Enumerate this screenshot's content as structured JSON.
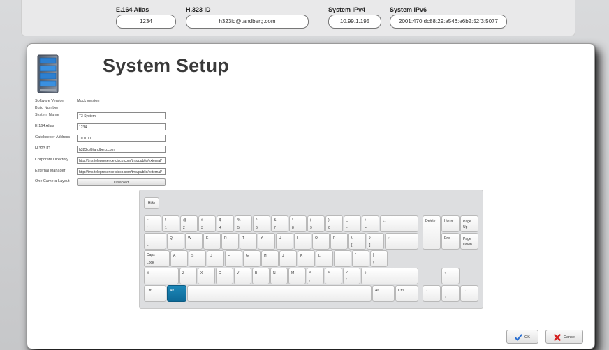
{
  "header": {
    "fields": [
      {
        "label": "E.164 Alias",
        "value": "1234"
      },
      {
        "label": "H.323 ID",
        "value": "h323id@tandberg.com"
      },
      {
        "label": "System IPv4",
        "value": "10.99.1.195"
      },
      {
        "label": "System IPv6",
        "value": "2001:470:dc88:29:a546:e6b2:52f3:5077"
      }
    ]
  },
  "window": {
    "title": "System Setup",
    "icon": "server-icon",
    "form": {
      "software_version_label": "Software Version",
      "software_version_value": "Mock version",
      "build_number_label": "Build Number",
      "rows": [
        {
          "label": "System Name",
          "value": "T3 System"
        },
        {
          "label": "E.164 Alias",
          "value": "1234"
        },
        {
          "label": "Gatekeeper Address",
          "value": "10.0.0.1"
        },
        {
          "label": "H.323 ID",
          "value": "h323id@tandberg.com"
        },
        {
          "label": "Corporate Directory",
          "value": "http://tms.telepresence.cisco.com/tms/public/external/"
        },
        {
          "label": "External Manager",
          "value": "http://tms.telepresence.cisco.com/tms/public/external/"
        }
      ],
      "one_camera_layout_label": "One Camera Layout",
      "one_camera_layout_value": "Disabled"
    },
    "keyboard": {
      "hide_label": "Hide",
      "number_row": [
        {
          "p": "~",
          "s": "`"
        },
        {
          "p": "!",
          "s": "1"
        },
        {
          "p": "@",
          "s": "2"
        },
        {
          "p": "#",
          "s": "3"
        },
        {
          "p": "$",
          "s": "4"
        },
        {
          "p": "%",
          "s": "5"
        },
        {
          "p": "^",
          "s": "6"
        },
        {
          "p": "&",
          "s": "7"
        },
        {
          "p": "*",
          "s": "8"
        },
        {
          "p": "(",
          "s": "9"
        },
        {
          "p": ")",
          "s": "0"
        },
        {
          "p": "_",
          "s": "-"
        },
        {
          "p": "+",
          "s": "="
        }
      ],
      "backspace": "←",
      "tab": {
        "p": "→",
        "s": "←"
      },
      "qwerty_row": [
        "Q",
        "W",
        "E",
        "R",
        "T",
        "Y",
        "U",
        "I",
        "O",
        "P"
      ],
      "bracket_keys": [
        {
          "p": "{",
          "s": "["
        },
        {
          "p": "}",
          "s": "]"
        }
      ],
      "enter": "↵",
      "caps": {
        "p": "Caps",
        "s": "Lock"
      },
      "home_row": [
        "A",
        "S",
        "D",
        "F",
        "G",
        "H",
        "J",
        "K",
        "L"
      ],
      "home_row_extra": [
        {
          "p": ":",
          "s": ";"
        },
        {
          "p": "\"",
          "s": "'"
        },
        {
          "p": "|",
          "s": "\\"
        }
      ],
      "shift_left": "⇧",
      "bottom_letters": [
        "Z",
        "X",
        "C",
        "V",
        "B",
        "N",
        "M"
      ],
      "bottom_extra": [
        {
          "p": "<",
          "s": ","
        },
        {
          "p": ">",
          "s": "."
        },
        {
          "p": "?",
          "s": "/"
        }
      ],
      "shift_right": "⇧",
      "ctrl_left": "Ctrl",
      "alt_left": "Alt",
      "alt_right": "Alt",
      "ctrl_right": "Ctrl",
      "nav": {
        "delete": "Delete",
        "home": "Home",
        "page_up": "Page Up",
        "end": "End",
        "page_down": "Page Down",
        "up": "↑",
        "left": "←",
        "down": "↓",
        "right": "→"
      }
    },
    "buttons": {
      "ok": "OK",
      "cancel": "Cancel"
    }
  },
  "colors": {
    "accent": "#0e6a98",
    "ok_check": "#2a6fd1",
    "cancel_x": "#d42020"
  }
}
